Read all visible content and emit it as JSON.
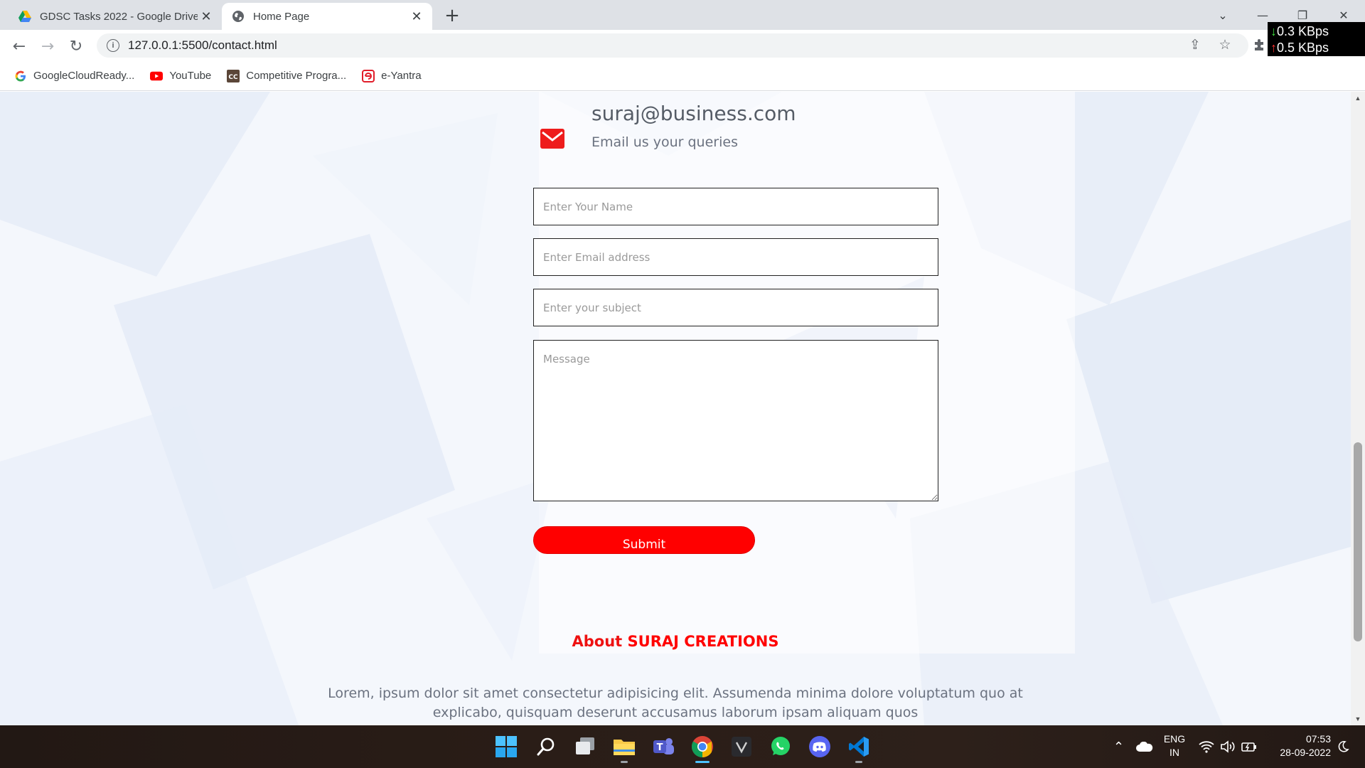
{
  "browser": {
    "tabs": [
      {
        "title": "GDSC Tasks 2022 - Google Drive",
        "icon": "google-drive-icon"
      },
      {
        "title": "Home Page",
        "icon": "globe-icon",
        "active": true
      }
    ],
    "url": "127.0.0.1:5500/contact.html",
    "network_speed": {
      "download": "0.3 KBps",
      "upload": "0.5 KBps"
    },
    "bookmarks": [
      {
        "label": "GoogleCloudReady...",
        "icon": "google-icon"
      },
      {
        "label": "YouTube",
        "icon": "youtube-icon"
      },
      {
        "label": "Competitive Progra...",
        "icon": "cc-icon"
      },
      {
        "label": "e-Yantra",
        "icon": "e-yantra-icon"
      }
    ]
  },
  "contact": {
    "email": "suraj@business.com",
    "email_caption": "Email us your queries"
  },
  "form": {
    "name_placeholder": "Enter Your Name",
    "email_placeholder": "Enter Email address",
    "subject_placeholder": "Enter your subject",
    "message_placeholder": "Message",
    "submit_label": "Submit"
  },
  "about": {
    "prefix": "About ",
    "brand": "SURAJ CREATIONS",
    "text": "Lorem, ipsum dolor sit amet consectetur adipisicing elit. Assumenda minima dolore voluptatum quo at explicabo, quisquam deserunt accusamus laborum ipsam aliquam quos"
  },
  "taskbar": {
    "apps": [
      "windows-start-icon",
      "search-icon",
      "task-view-icon",
      "file-explorer-icon",
      "teams-icon",
      "chrome-icon",
      "vectr-icon",
      "whatsapp-icon",
      "discord-icon",
      "vscode-icon"
    ],
    "language": "ENG",
    "region": "IN",
    "time": "07:53",
    "date": "28-09-2022"
  },
  "colors": {
    "accent": "#ff0000",
    "taskbar": "#2a1d17"
  }
}
